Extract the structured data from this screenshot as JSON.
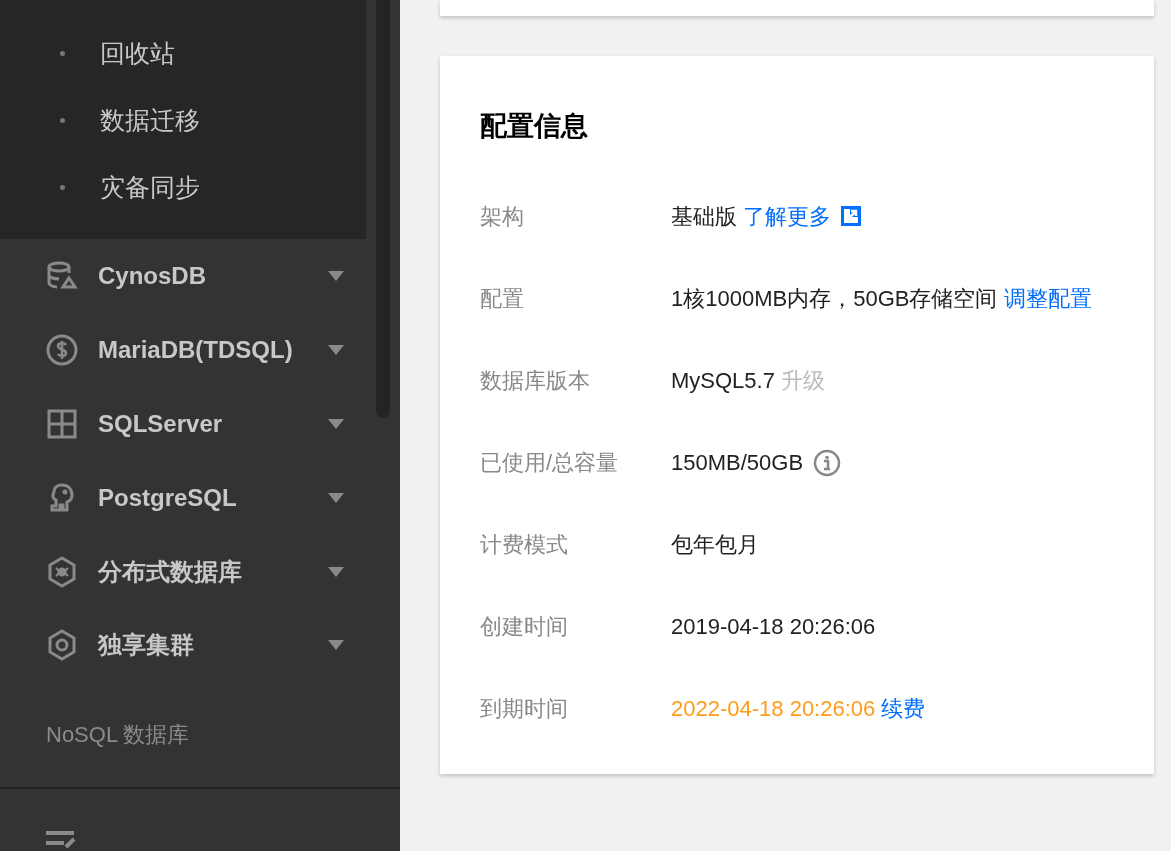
{
  "sidebar": {
    "sub_items": [
      "回收站",
      "数据迁移",
      "灾备同步"
    ],
    "menu": [
      {
        "label": "CynosDB"
      },
      {
        "label": "MariaDB(TDSQL)"
      },
      {
        "label": "SQLServer"
      },
      {
        "label": "PostgreSQL"
      },
      {
        "label": "分布式数据库"
      },
      {
        "label": "独享集群"
      }
    ],
    "section_label": "NoSQL 数据库"
  },
  "config_card": {
    "title": "配置信息",
    "rows": [
      {
        "label": "架构",
        "value": "基础版",
        "warning": false,
        "action": {
          "label": "了解更多",
          "disabled": false,
          "external": true
        },
        "info": false
      },
      {
        "label": "配置",
        "value": "1核1000MB内存，50GB存储空间",
        "warning": false,
        "action": {
          "label": "调整配置",
          "disabled": false,
          "external": false
        },
        "info": false
      },
      {
        "label": "数据库版本",
        "value": "MySQL5.7",
        "warning": false,
        "action": {
          "label": "升级",
          "disabled": true,
          "external": false
        },
        "info": false
      },
      {
        "label": "已使用/总容量",
        "value": "150MB/50GB",
        "warning": false,
        "info": true
      },
      {
        "label": "计费模式",
        "value": "包年包月",
        "warning": false,
        "info": false
      },
      {
        "label": "创建时间",
        "value": "2019-04-18 20:26:06",
        "warning": false,
        "info": false
      },
      {
        "label": "到期时间",
        "value": "2022-04-18 20:26:06",
        "warning": true,
        "action": {
          "label": "续费",
          "disabled": false,
          "external": false
        },
        "info": false
      }
    ]
  }
}
